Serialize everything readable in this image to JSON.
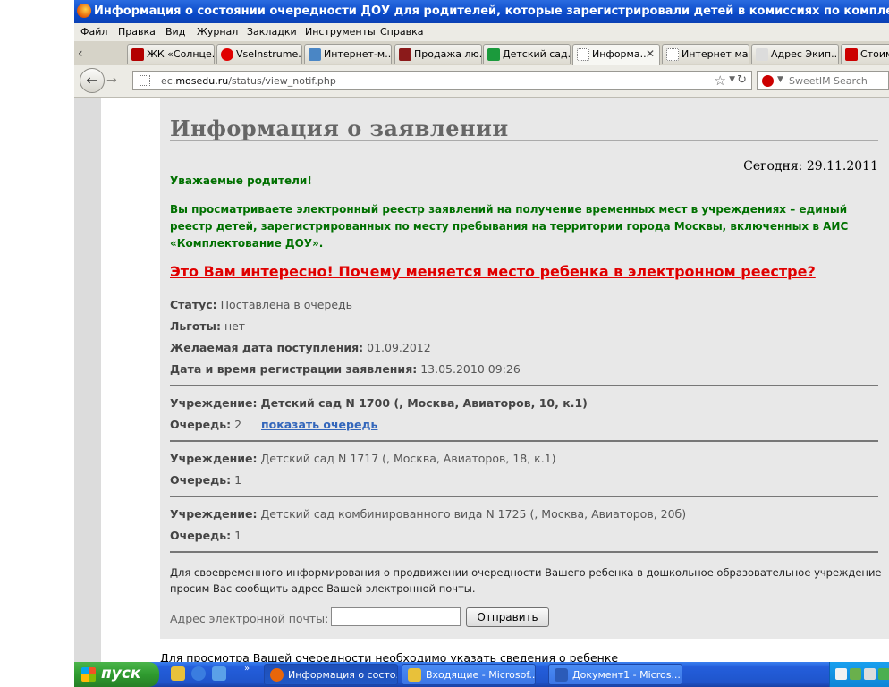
{
  "window": {
    "title": "Информация о состоянии очередности ДОУ для родителей, которые зарегистрировали детей в комиссиях по комплектованию до 01.10.20"
  },
  "menu": [
    "Файл",
    "Правка",
    "Вид",
    "Журнал",
    "Закладки",
    "Инструменты",
    "Справка"
  ],
  "tabs": [
    {
      "label": "ЖК «Солнце...",
      "icon_color": "#b30000"
    },
    {
      "label": "VseInstrume...",
      "icon_color": "#e00000"
    },
    {
      "label": "Интернет-м...",
      "icon_color": "#4a86c5"
    },
    {
      "label": "Продажа лю...",
      "icon_color": "#8b1a1a"
    },
    {
      "label": "Детский сад...",
      "icon_color": "#1b9a3c"
    },
    {
      "label": "Информа...",
      "icon_color": "#ffffff",
      "active": true
    },
    {
      "label": "Интернет ма...",
      "icon_color": "#ffffff"
    },
    {
      "label": "Адрес Экип...",
      "icon_color": "#dcdcdc"
    },
    {
      "label": "Стоим",
      "icon_color": "#cc0000"
    }
  ],
  "navbar": {
    "url_prefix": "ec.",
    "url_domain": "mosedu.ru",
    "url_path": "/status/view_notif.php",
    "search_placeholder": "SweetIM Search"
  },
  "page": {
    "heading": "Информация о заявлении",
    "today": "Сегодня: 29.11.2011",
    "greeting": "Уважаемые родители!",
    "intro": "Вы просматриваете электронный реестр заявлений на получение временных мест в учреждениях – единый реестр детей, зарегистрированных по месту пребывания на территории города Москвы, включенных в АИС «Комплектование ДОУ».",
    "promo_link": "Это Вам интересно!  Почему меняется место ребенка в электронном реестре?",
    "status_label": "Статус:",
    "status_value": "Поставлена в очередь",
    "benefits_label": "Льготы:",
    "benefits_value": "нет",
    "desired_date_label": "Желаемая дата поступления:",
    "desired_date_value": "01.09.2012",
    "reg_date_label": "Дата и время регистрации заявления:",
    "reg_date_value": "13.05.2010 09:26",
    "institutions": [
      {
        "label": "Учреждение:",
        "name": "Детский сад N 1700 (, Москва, Авиаторов, 10, к.1)",
        "queue_label": "Очередь:",
        "queue": "2",
        "show_queue": "показать очередь"
      },
      {
        "label": "Учреждение:",
        "name": "Детский сад N 1717 (, Москва, Авиаторов, 18, к.1)",
        "queue_label": "Очередь:",
        "queue": "1"
      },
      {
        "label": "Учреждение:",
        "name": "Детский сад комбинированного вида N 1725 (, Москва, Авиаторов, 20б)",
        "queue_label": "Очередь:",
        "queue": "1"
      }
    ],
    "notice": "Для своевременного информирования о продвижении очередности Вашего ребенка в дошкольное образовательное учреждение просим Вас сообщить адрес Вашей электронной почты.",
    "email_label": "Адрес электронной почты:",
    "email_value": "",
    "send_button": "Отправить",
    "below_text": "Для просмотра Вашей очередности необходимо указать сведения о ребенке"
  },
  "taskbar": {
    "start": "пуск",
    "buttons": [
      {
        "label": "Информация о состо...",
        "icon_color": "#e8660b",
        "active": true
      },
      {
        "label": "Входящие - Microsof...",
        "icon_color": "#e8c13a"
      },
      {
        "label": "Документ1 - Micros...",
        "icon_color": "#2b5bb8"
      }
    ]
  }
}
